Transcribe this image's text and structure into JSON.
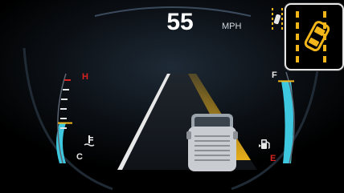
{
  "speed": {
    "value": "55",
    "unit": "MPH"
  },
  "temp_gauge": {
    "high_label": "H",
    "low_label": "C",
    "level": 0.45,
    "icon": "coolant-temp-icon"
  },
  "fuel_gauge": {
    "full_label": "F",
    "empty_label": "E",
    "level": 0.9,
    "icon": "fuel-pump-icon"
  },
  "alert": {
    "icon": "lane-departure-warning-icon",
    "small_icon": "lane-keep-assist-icon"
  },
  "colors": {
    "accent": "#f2b61b",
    "gauge_fill": "#3ec8e0",
    "warning_red": "#d62222",
    "lane_white": "#e8e8e8"
  }
}
